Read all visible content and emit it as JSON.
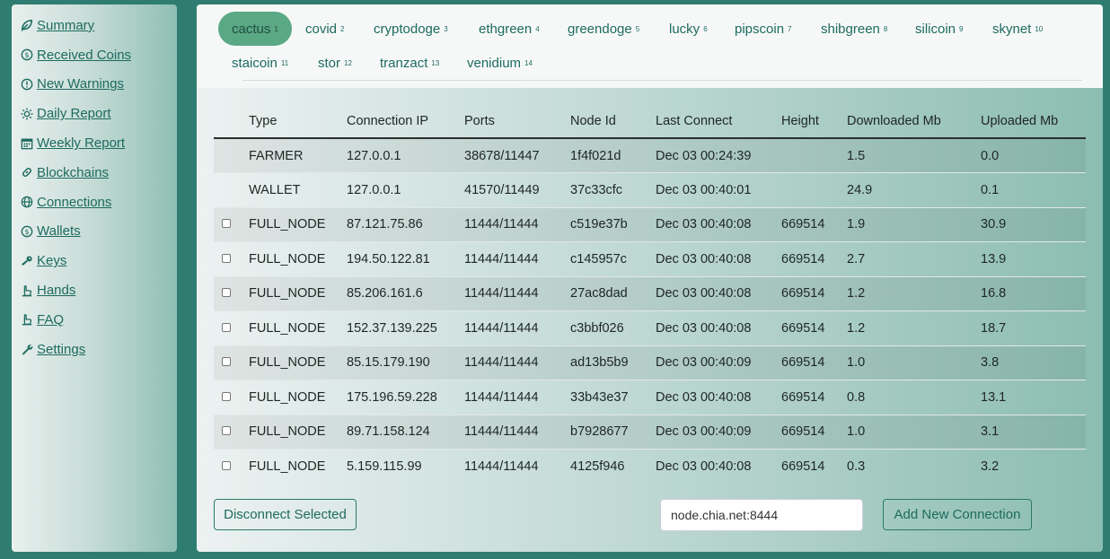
{
  "sidebar": {
    "items": [
      {
        "label": "Summary",
        "icon": "leaf-icon"
      },
      {
        "label": "Received Coins",
        "icon": "coin-icon"
      },
      {
        "label": "New Warnings",
        "icon": "warning-icon"
      },
      {
        "label": "Daily Report",
        "icon": "sun-icon"
      },
      {
        "label": "Weekly Report",
        "icon": "calendar-icon"
      },
      {
        "label": "Blockchains",
        "icon": "link-icon"
      },
      {
        "label": "Connections",
        "icon": "globe-icon"
      },
      {
        "label": "Wallets",
        "icon": "coin-icon"
      },
      {
        "label": "Keys",
        "icon": "key-icon"
      },
      {
        "label": "Hands",
        "icon": "hand-icon"
      },
      {
        "label": "FAQ",
        "icon": "hand-icon"
      },
      {
        "label": "Settings",
        "icon": "wrench-icon"
      }
    ]
  },
  "tabs": [
    {
      "label": "cactus",
      "count": "1",
      "active": true
    },
    {
      "label": "covid",
      "count": "2"
    },
    {
      "label": "cryptodoge",
      "count": "3"
    },
    {
      "label": "ethgreen",
      "count": "4"
    },
    {
      "label": "greendoge",
      "count": "5"
    },
    {
      "label": "lucky",
      "count": "6"
    },
    {
      "label": "pipscoin",
      "count": "7"
    },
    {
      "label": "shibgreen",
      "count": "8"
    },
    {
      "label": "silicoin",
      "count": "9"
    },
    {
      "label": "skynet",
      "count": "10"
    },
    {
      "label": "staicoin",
      "count": "11"
    },
    {
      "label": "stor",
      "count": "12"
    },
    {
      "label": "tranzact",
      "count": "13"
    },
    {
      "label": "venidium",
      "count": "14"
    }
  ],
  "table": {
    "headers": [
      "Type",
      "Connection IP",
      "Ports",
      "Node Id",
      "Last Connect",
      "Height",
      "Downloaded Mb",
      "Uploaded Mb"
    ],
    "rows": [
      {
        "checkbox": false,
        "cells": [
          "FARMER",
          "127.0.0.1",
          "38678/11447",
          "1f4f021d",
          "Dec 03 00:24:39",
          "",
          "1.5",
          "0.0"
        ]
      },
      {
        "checkbox": false,
        "cells": [
          "WALLET",
          "127.0.0.1",
          "41570/11449",
          "37c33cfc",
          "Dec 03 00:40:01",
          "",
          "24.9",
          "0.1"
        ]
      },
      {
        "checkbox": true,
        "cells": [
          "FULL_NODE",
          "87.121.75.86",
          "11444/11444",
          "c519e37b",
          "Dec 03 00:40:08",
          "669514",
          "1.9",
          "30.9"
        ]
      },
      {
        "checkbox": true,
        "cells": [
          "FULL_NODE",
          "194.50.122.81",
          "11444/11444",
          "c145957c",
          "Dec 03 00:40:08",
          "669514",
          "2.7",
          "13.9"
        ]
      },
      {
        "checkbox": true,
        "cells": [
          "FULL_NODE",
          "85.206.161.6",
          "11444/11444",
          "27ac8dad",
          "Dec 03 00:40:08",
          "669514",
          "1.2",
          "16.8"
        ]
      },
      {
        "checkbox": true,
        "cells": [
          "FULL_NODE",
          "152.37.139.225",
          "11444/11444",
          "c3bbf026",
          "Dec 03 00:40:08",
          "669514",
          "1.2",
          "18.7"
        ]
      },
      {
        "checkbox": true,
        "cells": [
          "FULL_NODE",
          "85.15.179.190",
          "11444/11444",
          "ad13b5b9",
          "Dec 03 00:40:09",
          "669514",
          "1.0",
          "3.8"
        ]
      },
      {
        "checkbox": true,
        "cells": [
          "FULL_NODE",
          "175.196.59.228",
          "11444/11444",
          "33b43e37",
          "Dec 03 00:40:08",
          "669514",
          "0.8",
          "13.1"
        ]
      },
      {
        "checkbox": true,
        "cells": [
          "FULL_NODE",
          "89.71.158.124",
          "11444/11444",
          "b7928677",
          "Dec 03 00:40:09",
          "669514",
          "1.0",
          "3.1"
        ]
      },
      {
        "checkbox": true,
        "cells": [
          "FULL_NODE",
          "5.159.115.99",
          "11444/11444",
          "4125f946",
          "Dec 03 00:40:08",
          "669514",
          "0.3",
          "3.2"
        ]
      }
    ]
  },
  "actions": {
    "disconnect_label": "Disconnect Selected",
    "add_label": "Add New Connection",
    "host_value": "node.chia.net:8444"
  },
  "colors": {
    "accent": "#1d6b5f",
    "active_tab": "#5aa884",
    "background": "#2f7d70"
  }
}
